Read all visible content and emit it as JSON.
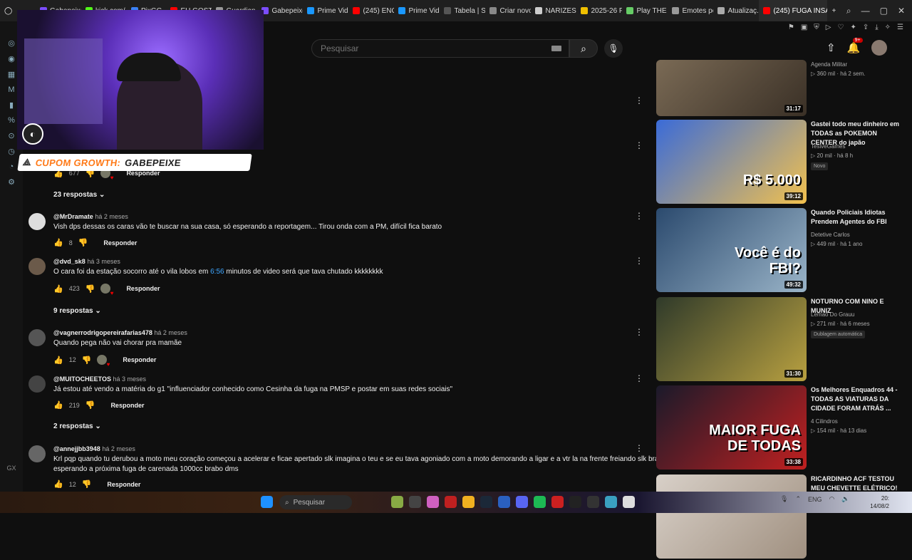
{
  "tabs": [
    {
      "label": "Gabepeixe",
      "color": "#7b4dff"
    },
    {
      "label": "kick.com/...",
      "color": "#53fc18"
    },
    {
      "label": "PixGG",
      "color": "#3b82f6"
    },
    {
      "label": "EU GOSTO",
      "color": "#ff0000"
    },
    {
      "label": "Guardian",
      "color": "#999999"
    },
    {
      "label": "Gabepeixe",
      "color": "#7b4dff"
    },
    {
      "label": "Prime Vide",
      "color": "#1a98ff"
    },
    {
      "label": "(245) ENC",
      "color": "#ff0000"
    },
    {
      "label": "Prime Vide",
      "color": "#1a98ff"
    },
    {
      "label": "Tabela | S",
      "color": "#555555"
    },
    {
      "label": "Criar novo",
      "color": "#888888"
    },
    {
      "label": "NARIZES F",
      "color": "#cccccc"
    },
    {
      "label": "2025-26 F",
      "color": "#f0c000"
    },
    {
      "label": "Play THE F",
      "color": "#66cc66"
    },
    {
      "label": "Emotes pc",
      "color": "#999999"
    },
    {
      "label": "Atualizaç...",
      "color": "#aaaaaa"
    },
    {
      "label": "(245) FUGA INSAN",
      "color": "#ff0000",
      "active": true
    }
  ],
  "search": {
    "placeholder": "Pesquisar"
  },
  "notifications": {
    "count": "9+"
  },
  "overlay": {
    "coupon_prefix": "CUPOM GROWTH:",
    "coupon_code": "GABEPEIXE"
  },
  "comments": {
    "top_partial": {
      "likes": "677",
      "reply_label": "Responder",
      "replies_label": "23 respostas"
    },
    "items": [
      {
        "user": "@MrDramate",
        "time": "há 2 meses",
        "text": "Vish dps dessas os caras vão te buscar na sua casa, só esperando a reportagem... Tirou onda com a PM, difícil fica barato",
        "likes": "8",
        "reply_label": "Responder",
        "avatar_color": "#dddddd"
      },
      {
        "user": "@dvd_sk8",
        "time": "há 3 meses",
        "text_before": "O cara foi da estação socorro até o vila lobos em ",
        "link": "6:56",
        "text_after": " minutos de video será que tava chutado kkkkkkkk",
        "likes": "423",
        "reply_label": "Responder",
        "replies_label": "9 respostas",
        "avatar_color": "#6b5a4a"
      },
      {
        "user": "@vagnerrodrigopereirafarias478",
        "time": "há 2 meses",
        "text": "Quando pega não vai chorar pra mamãe",
        "likes": "12",
        "reply_label": "Responder",
        "avatar_color": "#555555"
      },
      {
        "user": "@MUITOCHEETOS",
        "time": "há 3 meses",
        "text": "Já estou até vendo a matéria do g1 \"influenciador conhecido como Cesinha da fuga na PMSP e postar em suas redes sociais\"",
        "likes": "219",
        "reply_label": "Responder",
        "replies_label": "2 respostas",
        "avatar_color": "#444444"
      },
      {
        "user": "@annejjbb3948",
        "time": "há 2 meses",
        "text_line1": "Krl pqp quando tu derubou a moto meu coração começou a acelerar e ficae apertado slk imagina o teu e se eu tava agoniado com a moto demorando a ligar e a vtr la na frente freiando slk brabo dms ja",
        "text_line2": "esperando a próxima fuga de carenada 1000cc brabo dms",
        "likes": "12",
        "reply_label": "Responder",
        "avatar_color": "#666666"
      }
    ]
  },
  "sidebar": {
    "videos": [
      {
        "title": "",
        "channel": "Agenda Militar",
        "meta": "360 mil · há 2 sem.",
        "duration": "31:17",
        "thumb": [
          "#7a6a55",
          "#3a3026"
        ]
      },
      {
        "title": "Gastei todo meu dinheiro em TODAS as POKEMON CENTER do japão",
        "channel": "TesiveGames",
        "meta": "20 mil · há 8 h",
        "badge": "Novo",
        "duration": "39:12",
        "thumb_text": "R$ 5.000",
        "thumb": [
          "#3a6bd8",
          "#f2c14e"
        ]
      },
      {
        "title": "Quando Policiais Idiotas Prendem Agentes do FBI",
        "channel": "Detetive Carlos",
        "meta": "449 mil · há 1 ano",
        "duration": "49:32",
        "thumb_text": "Você é do FBI?",
        "thumb": [
          "#2b4a6e",
          "#9ab4c8"
        ]
      },
      {
        "title": "NOTURNO COM NINO E MUNIZ",
        "channel": "Lemao Do Grauu",
        "meta": "271 mil · há 6 meses",
        "badge": "Dublagem automática",
        "duration": "31:30",
        "thumb": [
          "#2f3a2a",
          "#b8a040"
        ]
      },
      {
        "title": "Os Melhores Enquadros 44 - TODAS AS VIATURAS DA CIDADE FORAM ATRÁS ...",
        "channel": "4 Cilindros",
        "meta": "154 mil · há 13 dias",
        "duration": "33:38",
        "thumb_text": "MAIOR FUGA DE TODAS",
        "thumb": [
          "#1a1a2a",
          "#c02020"
        ]
      },
      {
        "title": "RICARDINHO ACF TESTOU MEU CHEVETTE ELÉTRICO!",
        "channel": "",
        "meta": "",
        "duration": "",
        "thumb": [
          "#d8d0c8",
          "#a09080"
        ]
      }
    ]
  },
  "taskbar": {
    "search_label": "Pesquisar",
    "tray_lang": "ENG",
    "clock_time": "20:",
    "clock_date": "14/08/2"
  }
}
